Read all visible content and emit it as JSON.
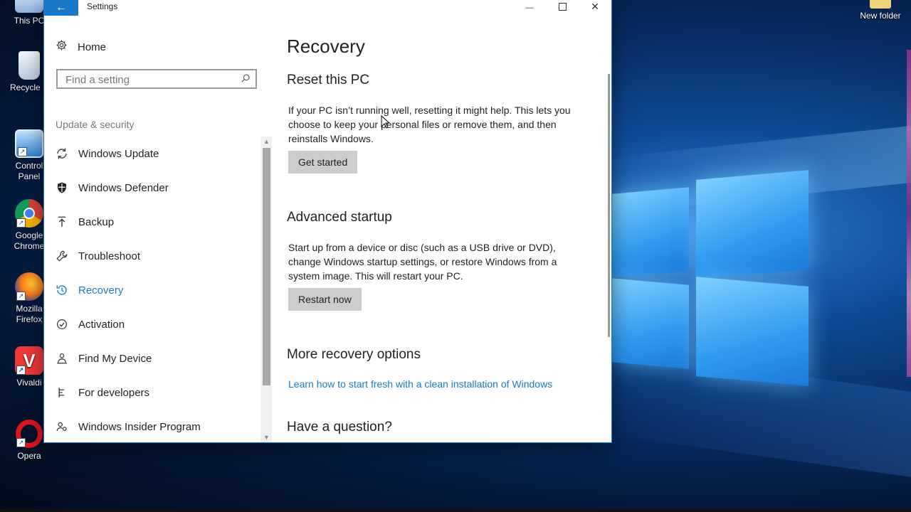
{
  "window": {
    "title": "Settings",
    "back_icon": "←",
    "minimize_icon": "—",
    "close_icon": "✕"
  },
  "sidebar": {
    "home_label": "Home",
    "search_placeholder": "Find a setting",
    "section_title": "Update & security",
    "items": [
      {
        "label": "Windows Update",
        "icon": "sync-icon"
      },
      {
        "label": "Windows Defender",
        "icon": "shield-icon"
      },
      {
        "label": "Backup",
        "icon": "backup-arrow-icon"
      },
      {
        "label": "Troubleshoot",
        "icon": "wrench-icon"
      },
      {
        "label": "Recovery",
        "icon": "history-icon",
        "active": true
      },
      {
        "label": "Activation",
        "icon": "check-circle-icon"
      },
      {
        "label": "Find My Device",
        "icon": "person-pin-icon"
      },
      {
        "label": "For developers",
        "icon": "developer-tools-icon"
      },
      {
        "label": "Windows Insider Program",
        "icon": "insider-icon"
      }
    ]
  },
  "content": {
    "title": "Recovery",
    "reset": {
      "heading": "Reset this PC",
      "text": "If your PC isn’t running well, resetting it might help. This lets you choose to keep your personal files or remove them, and then reinstalls Windows.",
      "button": "Get started"
    },
    "advanced": {
      "heading": "Advanced startup",
      "text": "Start up from a device or disc (such as a USB drive or DVD), change Windows startup settings, or restore Windows from a system image. This will restart your PC.",
      "button": "Restart now"
    },
    "more": {
      "heading": "More recovery options",
      "link": "Learn how to start fresh with a clean installation of Windows"
    },
    "question": {
      "heading": "Have a question?"
    }
  },
  "desktop": {
    "icons_left": [
      {
        "label": "This PC"
      },
      {
        "label": "Recycle B"
      },
      {
        "label": "Control Panel"
      },
      {
        "label": "Google Chrome"
      },
      {
        "label": "Mozilla Firefox"
      },
      {
        "label": "Vivaldi"
      },
      {
        "label": "Opera"
      }
    ],
    "icon_right": {
      "label": "New folder"
    }
  },
  "colors": {
    "accent": "#1979ca",
    "button_bg": "#cccccc"
  }
}
